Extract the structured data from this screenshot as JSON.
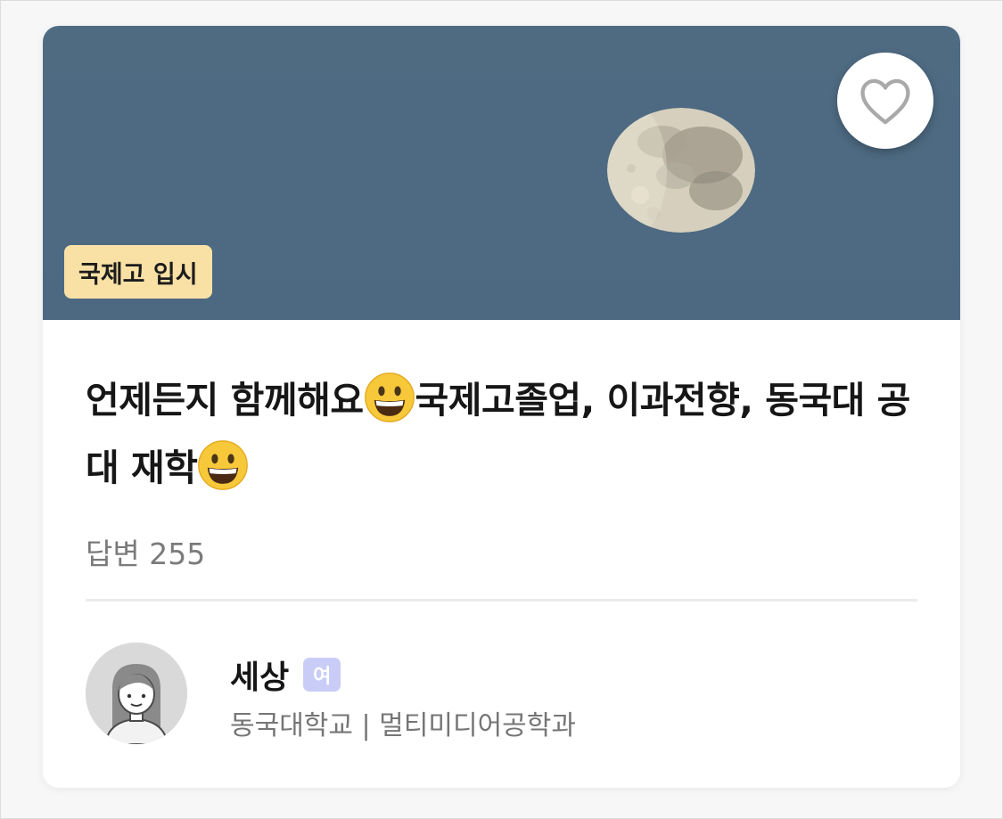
{
  "post": {
    "tag": "국제고 입시",
    "title_part1": "언제든지 함께해요",
    "title_part2": "국제고졸업, 이과전향, 동국대 공대 재학",
    "title_emoji": "grinning-face-emoji",
    "answers_label": "답변 255"
  },
  "author": {
    "name": "세상",
    "gender_badge": "여",
    "school": "동국대학교 | 멀티미디어공학과"
  },
  "icons": {
    "favorite": "heart-outline-icon",
    "avatar": "female-avatar-icon"
  },
  "colors": {
    "hero_sky": "#4f6b82",
    "tag_bg": "#f9e1a6",
    "badge_bg": "#c9ccf7",
    "muted_text": "#7b7b7b"
  }
}
